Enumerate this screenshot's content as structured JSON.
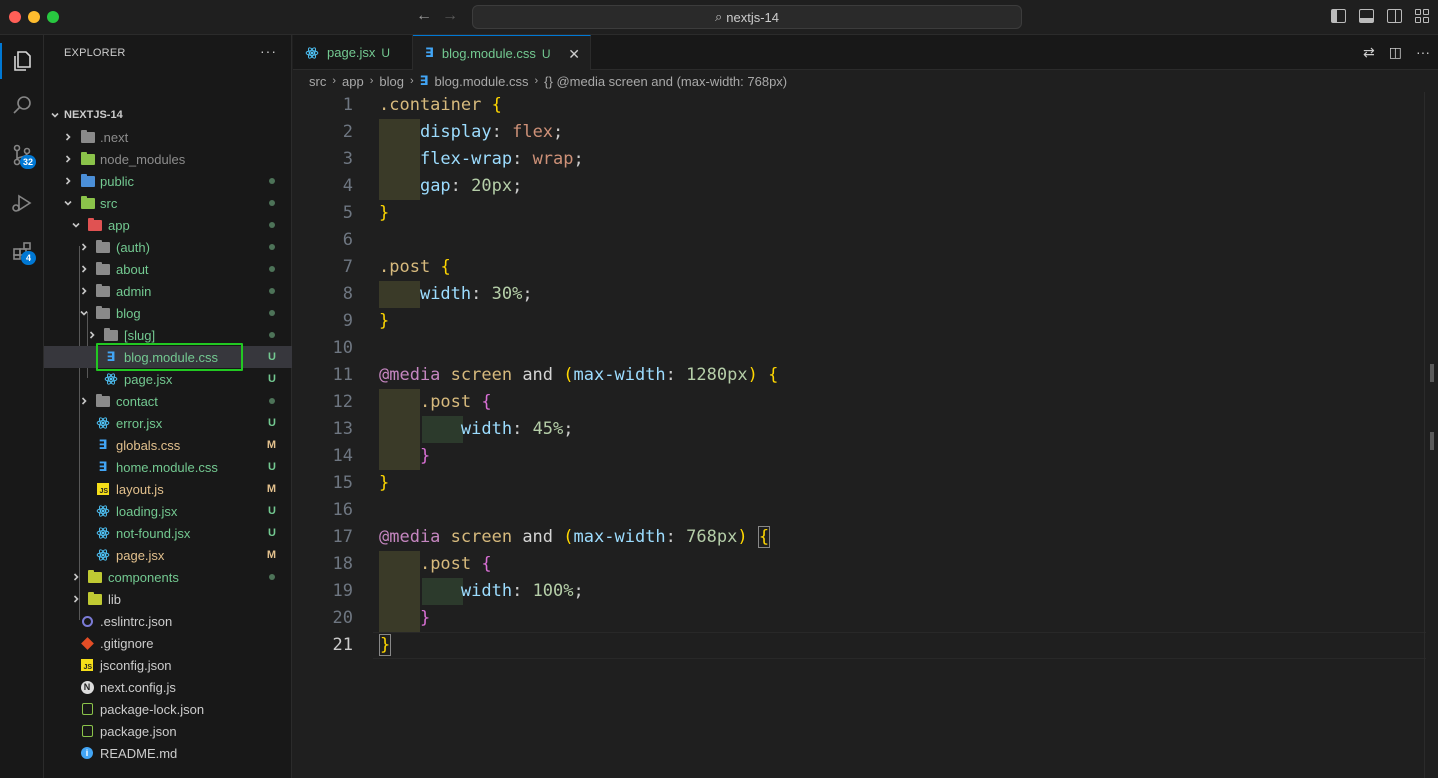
{
  "window": {
    "search_text": "nextjs-14"
  },
  "activity_bar": {
    "source_control_badge": "32",
    "extensions_badge": "4"
  },
  "sidebar": {
    "title": "EXPLORER",
    "more": "···",
    "project": "NEXTJS-14",
    "items": [
      {
        "label": ".next",
        "status": ""
      },
      {
        "label": "node_modules",
        "status": ""
      },
      {
        "label": "public",
        "status": ""
      },
      {
        "label": "src",
        "status": ""
      },
      {
        "label": "app",
        "status": ""
      },
      {
        "label": "(auth)",
        "status": ""
      },
      {
        "label": "about",
        "status": ""
      },
      {
        "label": "admin",
        "status": ""
      },
      {
        "label": "blog",
        "status": ""
      },
      {
        "label": "[slug]",
        "status": ""
      },
      {
        "label": "blog.module.css",
        "status": "U"
      },
      {
        "label": "page.jsx",
        "status": "U"
      },
      {
        "label": "contact",
        "status": ""
      },
      {
        "label": "error.jsx",
        "status": "U"
      },
      {
        "label": "globals.css",
        "status": "M"
      },
      {
        "label": "home.module.css",
        "status": "U"
      },
      {
        "label": "layout.js",
        "status": "M"
      },
      {
        "label": "loading.jsx",
        "status": "U"
      },
      {
        "label": "not-found.jsx",
        "status": "U"
      },
      {
        "label": "page.jsx",
        "status": "M"
      },
      {
        "label": "components",
        "status": ""
      },
      {
        "label": "lib",
        "status": ""
      },
      {
        "label": ".eslintrc.json",
        "status": ""
      },
      {
        "label": ".gitignore",
        "status": ""
      },
      {
        "label": "jsconfig.json",
        "status": ""
      },
      {
        "label": "next.config.js",
        "status": ""
      },
      {
        "label": "package-lock.json",
        "status": ""
      },
      {
        "label": "package.json",
        "status": ""
      },
      {
        "label": "README.md",
        "status": ""
      }
    ]
  },
  "tabs": [
    {
      "label": "page.jsx",
      "status": "U"
    },
    {
      "label": "blog.module.css",
      "status": "U",
      "close": "✕"
    }
  ],
  "breadcrumb": {
    "parts": [
      "src",
      "app",
      "blog",
      "blog.module.css"
    ],
    "symbol": "{} @media screen and (max-width: 768px)"
  },
  "editor": {
    "line_numbers": [
      "1",
      "2",
      "3",
      "4",
      "5",
      "6",
      "7",
      "8",
      "9",
      "10",
      "11",
      "12",
      "13",
      "14",
      "15",
      "16",
      "17",
      "18",
      "19",
      "20",
      "21"
    ]
  }
}
